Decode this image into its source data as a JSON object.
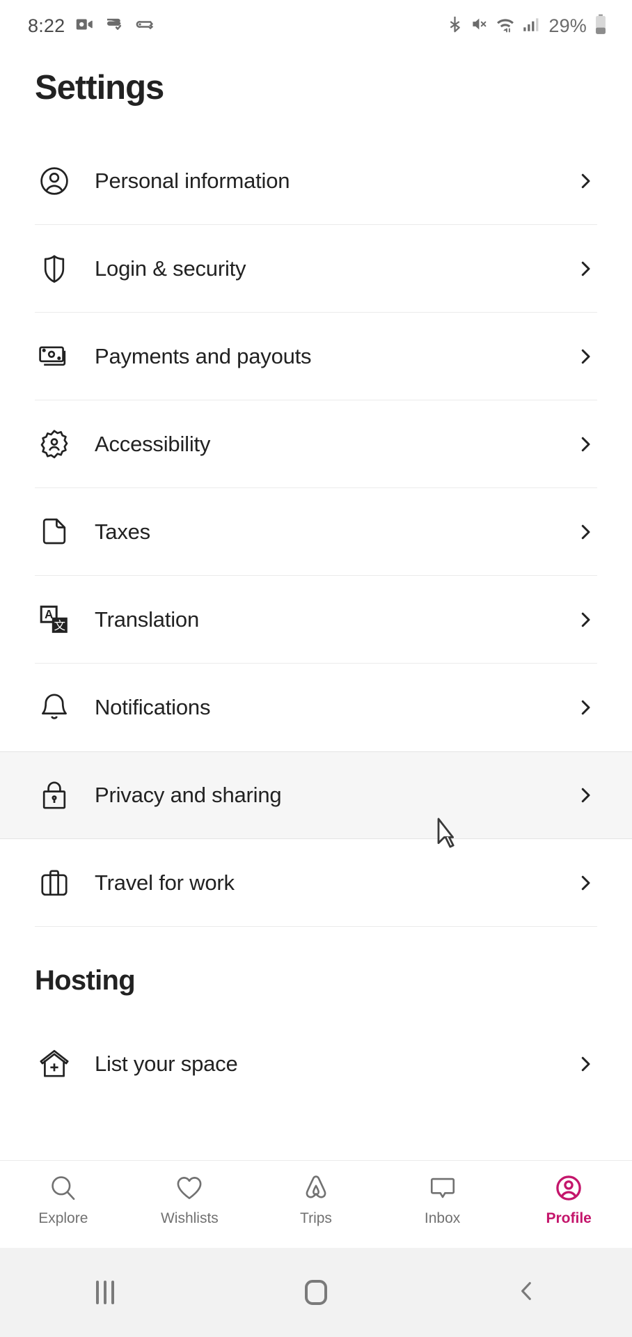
{
  "statusbar": {
    "time": "8:22",
    "battery_percent": "29%",
    "left_icons": [
      "video-camera-icon",
      "screen-record-icon",
      "vpn-key-icon"
    ],
    "right_icons": [
      "bluetooth-icon",
      "volume-mute-icon",
      "wifi-icon",
      "cellular-signal-icon",
      "battery-icon"
    ]
  },
  "header": {
    "title": "Settings"
  },
  "settings": {
    "items": [
      {
        "label": "Personal information",
        "icon": "user-circle-icon"
      },
      {
        "label": "Login & security",
        "icon": "shield-icon"
      },
      {
        "label": "Payments and payouts",
        "icon": "banknotes-icon"
      },
      {
        "label": "Accessibility",
        "icon": "gear-person-icon"
      },
      {
        "label": "Taxes",
        "icon": "document-icon"
      },
      {
        "label": "Translation",
        "icon": "translate-icon"
      },
      {
        "label": "Notifications",
        "icon": "bell-icon"
      },
      {
        "label": "Privacy and sharing",
        "icon": "lock-icon"
      },
      {
        "label": "Travel for work",
        "icon": "suitcase-icon"
      }
    ]
  },
  "hosting": {
    "title": "Hosting",
    "items": [
      {
        "label": "List your space",
        "icon": "house-plus-icon"
      }
    ]
  },
  "tabbar": {
    "active_color": "#c4156b",
    "tabs": [
      {
        "label": "Explore",
        "icon": "search-icon",
        "active": false
      },
      {
        "label": "Wishlists",
        "icon": "heart-icon",
        "active": false
      },
      {
        "label": "Trips",
        "icon": "airbnb-belo-icon",
        "active": false
      },
      {
        "label": "Inbox",
        "icon": "speech-bubble-icon",
        "active": false
      },
      {
        "label": "Profile",
        "icon": "user-circle-icon",
        "active": true
      }
    ]
  },
  "androidnav": {
    "buttons": [
      "recents-button",
      "home-button",
      "back-button"
    ]
  }
}
